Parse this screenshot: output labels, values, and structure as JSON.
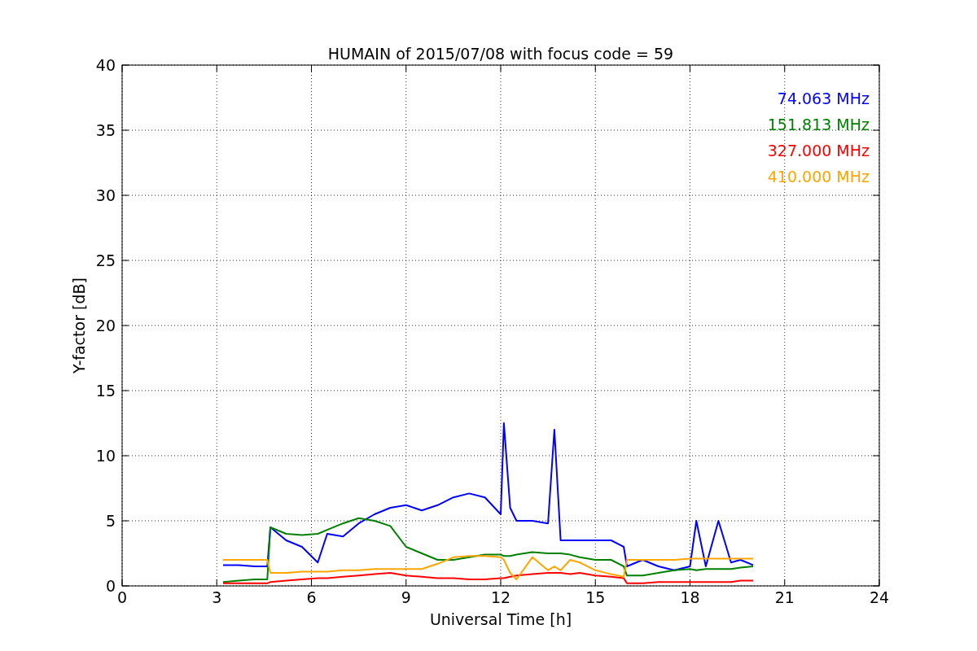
{
  "figure": {
    "chart_data": {
      "type": "line",
      "title": "HUMAIN of 2015/07/08 with focus code = 59",
      "xlabel": "Universal Time [h]",
      "ylabel": "Y-factor [dB]",
      "xlim": [
        0,
        24
      ],
      "ylim": [
        0,
        40
      ],
      "xticks": [
        0,
        3,
        6,
        9,
        12,
        15,
        18,
        21,
        24
      ],
      "yticks": [
        0,
        5,
        10,
        15,
        20,
        25,
        30,
        35,
        40
      ],
      "grid": true,
      "x": [
        3.2,
        3.7,
        4.2,
        4.6,
        4.7,
        5.2,
        5.7,
        6.2,
        6.5,
        7.0,
        7.5,
        8.0,
        8.5,
        9.0,
        9.5,
        10.0,
        10.5,
        11.0,
        11.5,
        12.0,
        12.1,
        12.3,
        12.5,
        13.0,
        13.5,
        13.7,
        13.9,
        14.2,
        14.5,
        15.0,
        15.5,
        15.9,
        16.0,
        16.5,
        17.0,
        17.5,
        18.0,
        18.2,
        18.5,
        18.9,
        19.3,
        19.6,
        20.0
      ],
      "series": [
        {
          "name": "74.063 MHz",
          "color": "#0000ff",
          "values": [
            1.6,
            1.6,
            1.5,
            1.5,
            4.5,
            3.5,
            3.0,
            1.8,
            4.0,
            3.8,
            4.8,
            5.5,
            6.0,
            6.2,
            5.8,
            6.2,
            6.8,
            7.1,
            6.8,
            5.5,
            12.5,
            6.0,
            5.0,
            5.0,
            4.8,
            12.0,
            3.5,
            3.5,
            3.5,
            3.5,
            3.5,
            3.0,
            1.5,
            2.0,
            1.5,
            1.2,
            1.5,
            5.0,
            1.5,
            5.0,
            1.8,
            2.0,
            1.6
          ]
        },
        {
          "name": "151.813 MHz",
          "color": "#008000",
          "values": [
            0.3,
            0.4,
            0.5,
            0.5,
            4.5,
            4.0,
            3.9,
            4.0,
            4.3,
            4.8,
            5.2,
            5.0,
            4.6,
            3.0,
            2.5,
            2.0,
            2.0,
            2.2,
            2.4,
            2.4,
            2.3,
            2.3,
            2.4,
            2.6,
            2.5,
            2.5,
            2.5,
            2.4,
            2.2,
            2.0,
            2.0,
            1.5,
            0.8,
            0.8,
            1.0,
            1.2,
            1.3,
            1.2,
            1.3,
            1.3,
            1.3,
            1.4,
            1.5
          ]
        },
        {
          "name": "327.000 MHz",
          "color": "#ff0000",
          "values": [
            0.2,
            0.2,
            0.2,
            0.2,
            0.3,
            0.4,
            0.5,
            0.6,
            0.6,
            0.7,
            0.8,
            0.9,
            1.0,
            0.8,
            0.7,
            0.6,
            0.6,
            0.5,
            0.5,
            0.6,
            0.6,
            0.7,
            0.8,
            0.9,
            1.0,
            1.0,
            1.0,
            0.9,
            1.0,
            0.8,
            0.7,
            0.6,
            0.2,
            0.2,
            0.3,
            0.3,
            0.3,
            0.3,
            0.3,
            0.3,
            0.3,
            0.4,
            0.4
          ]
        },
        {
          "name": "410.000 MHz",
          "color": "#ffa500",
          "values": [
            2.0,
            2.0,
            2.0,
            2.0,
            1.0,
            1.0,
            1.1,
            1.1,
            1.1,
            1.2,
            1.2,
            1.3,
            1.3,
            1.3,
            1.3,
            1.7,
            2.2,
            2.3,
            2.3,
            2.2,
            2.0,
            1.0,
            0.5,
            2.2,
            1.2,
            1.5,
            1.2,
            2.0,
            1.8,
            1.2,
            0.9,
            0.7,
            2.0,
            2.0,
            2.0,
            2.0,
            2.1,
            2.1,
            2.1,
            2.1,
            2.1,
            2.1,
            2.1
          ]
        }
      ]
    }
  }
}
